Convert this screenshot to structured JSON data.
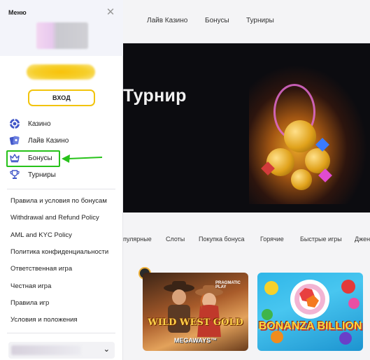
{
  "top_nav": [
    "Лайв Казино",
    "Бонусы",
    "Турниры"
  ],
  "hero": {
    "title": "Турнир"
  },
  "categories": [
    "пулярные",
    "Слоты",
    "Покупка бонуса",
    "Горячие",
    "Быстрые игры",
    "Джен"
  ],
  "games": [
    {
      "title": "WILD WEST GOLD",
      "subtitle": "MEGAWAYS™",
      "provider": "PRAGMATIC PLAY"
    },
    {
      "title": "BONANZA BILLION"
    }
  ],
  "sidebar": {
    "title": "Меню",
    "login_label": "ВХОД",
    "menu": [
      {
        "label": "Казино",
        "icon": "casino-chip-icon"
      },
      {
        "label": "Лайв Казино",
        "icon": "live-casino-cards-icon"
      },
      {
        "label": "Бонусы",
        "icon": "crown-icon"
      },
      {
        "label": "Турниры",
        "icon": "trophy-icon"
      }
    ],
    "links": [
      "Правила и условия по бонусам",
      "Withdrawal and Refund Policy",
      "AML and KYC Policy",
      "Политика конфиденциальности",
      "Ответственная игра",
      "Честная игра",
      "Правила игр",
      "Условия и положения"
    ]
  },
  "colors": {
    "accent_yellow": "#f2c40c",
    "highlight_green": "#27c21a",
    "icon_blue": "#4257c8"
  }
}
